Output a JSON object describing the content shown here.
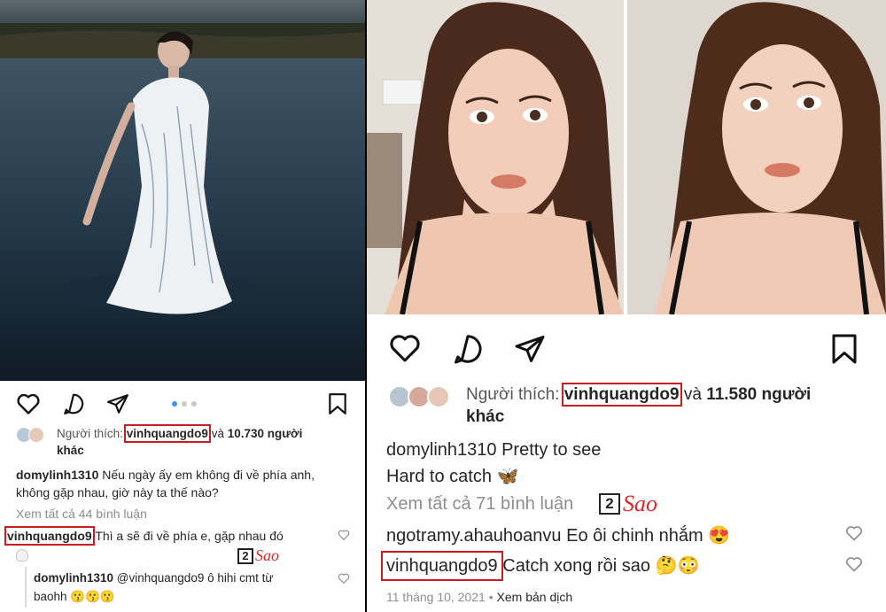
{
  "left_post": {
    "liked_by_prefix": "Người thích:",
    "liked_by_user": "vinhquangdo9",
    "liked_by_suffix_and": "và",
    "liked_by_others": "10.730 người",
    "liked_by_others_line2": "khác",
    "caption_user": "domylinh1310",
    "caption_text_line1": "Nếu ngày ấy em không đi về phía anh,",
    "caption_text_line2": "không gặp nhau, giờ này ta thế nào?",
    "view_comments": "Xem tất cả 44 bình luận",
    "comment1_user": "vinhquangdo9",
    "comment1_text": "Thì a sẽ đi về phía e, gặp nhau đó",
    "comment2_user": "domylinh1310",
    "comment2_mention": "@vinhquangdo9",
    "comment2_text": "ô hihi cmt từ",
    "comment2_text_line2": "baohh",
    "comment2_emojis": "😗😗😗",
    "brand_number": "2",
    "brand_word": "Sao"
  },
  "right_post": {
    "liked_by_prefix": "Người thích:",
    "liked_by_user": "vinhquangdo9",
    "liked_by_suffix_and": "và",
    "liked_by_others": "11.580 người",
    "liked_by_others_line2": "khác",
    "caption_user": "domylinh1310",
    "caption_text_line1": "Pretty to see",
    "caption_text_line2": "Hard to catch 🦋",
    "view_comments": "Xem tất cả 71 bình luận",
    "comment1_user": "ngotramy.ahauhoanvu",
    "comment1_text": "Eo ôi chinh nhắm 😍",
    "comment2_user": "vinhquangdo9",
    "comment2_text": "Catch xong rồi sao 🤔😳",
    "timestamp": "11 tháng 10, 2021",
    "separator": "•",
    "see_translation": "Xem bản dịch",
    "brand_number": "2",
    "brand_word": "Sao"
  },
  "colors": {
    "highlight_box": "#c81e1e",
    "brand_red": "#e0262b",
    "dot_active": "#3897f0"
  }
}
